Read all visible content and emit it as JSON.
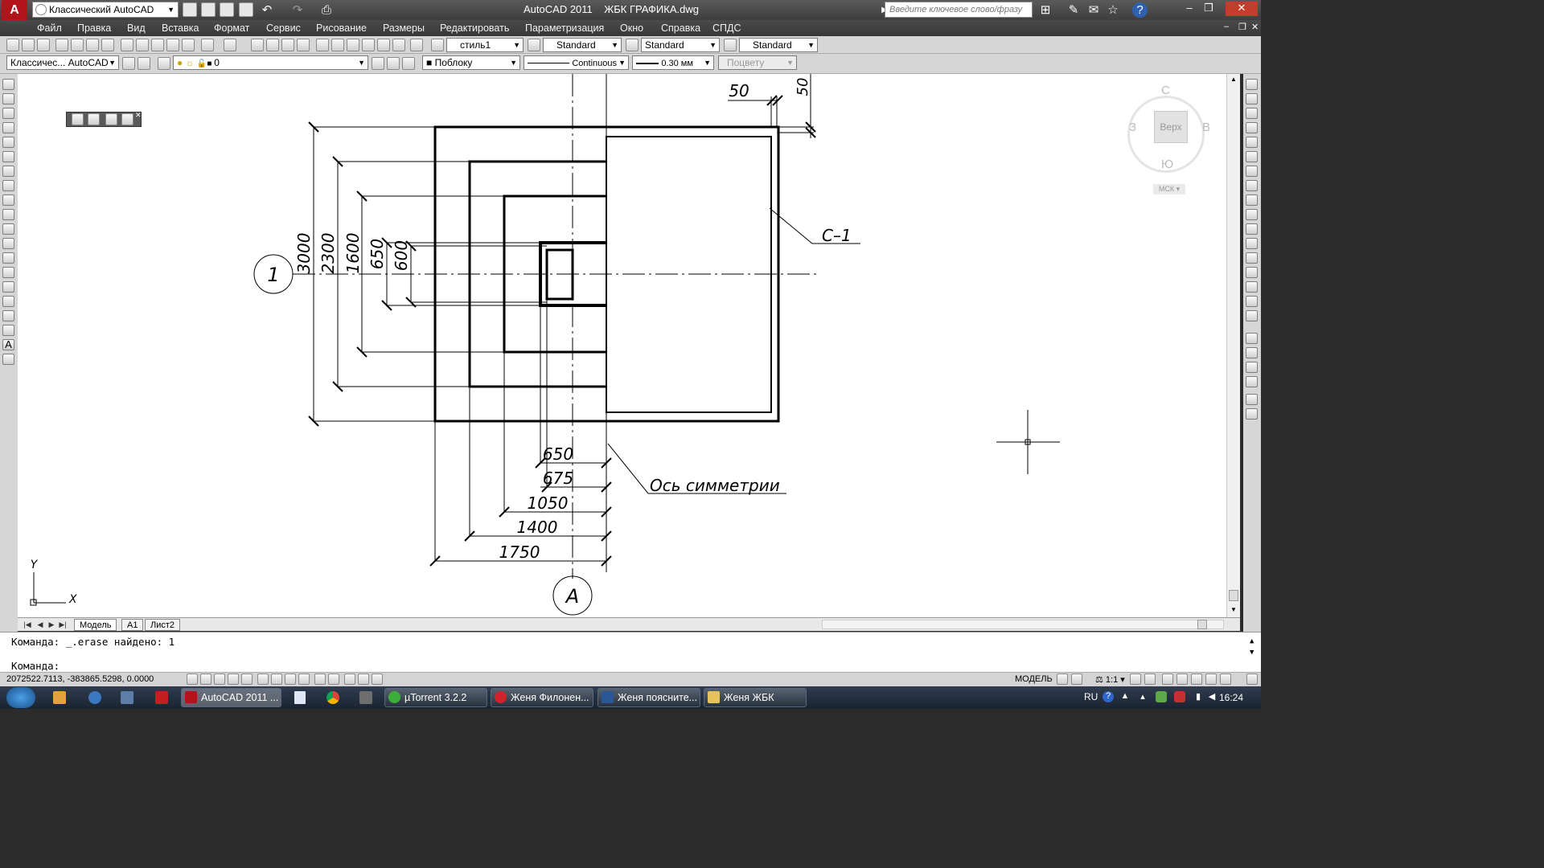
{
  "titlebar": {
    "workspace": "Классический AutoCAD",
    "app_title": "AutoCAD 2011",
    "document": "ЖБК ГРАФИКА.dwg",
    "search_placeholder": "Введите ключевое слово/фразу"
  },
  "menu": [
    "Файл",
    "Правка",
    "Вид",
    "Вставка",
    "Формат",
    "Сервис",
    "Рисование",
    "Размеры",
    "Редактировать",
    "Параметризация",
    "Окно",
    "Справка",
    "СПДС"
  ],
  "styles_toolbar": {
    "text_style": "стиль1",
    "dim_style": "Standard",
    "table_style": "Standard",
    "multileader_style": "Standard"
  },
  "layers_toolbar": {
    "workspace": "Классичес... AutoCAD",
    "layer": "0",
    "color": "Поблоку",
    "linetype": "Continuous",
    "lineweight": "0.30 мм",
    "plot_style": "Поцвету"
  },
  "viewcube": {
    "north": "С",
    "south": "Ю",
    "west": "З",
    "east": "В",
    "face": "Верх",
    "ucs": "МСК"
  },
  "drawing": {
    "row_axis": "1",
    "column_axis": "A",
    "vertical_dims": [
      "3000",
      "2300",
      "1600",
      "650",
      "600"
    ],
    "horizontal_dims": [
      "650",
      "675",
      "1050",
      "1400",
      "1750"
    ],
    "top_dims": [
      "50",
      "50"
    ],
    "section_label": "С–1",
    "symmetry_label": "Ось симметрии",
    "ucs_x": "X",
    "ucs_y": "Y"
  },
  "tabs": [
    "Модель",
    "A1",
    "Лист2"
  ],
  "command": {
    "history": "Команда:  _.erase найдено: 1",
    "prompt": "Команда:"
  },
  "status": {
    "coords": "2072522.7113, -383865.5298, 0.0000",
    "space": "МОДЕЛЬ",
    "scale": "1:1"
  },
  "taskbar": {
    "tasks": [
      "AutoCAD 2011 ...",
      "µTorrent 3.2.2",
      "Женя Филонен...",
      "Женя поясните...",
      "Женя ЖБК"
    ],
    "lang": "RU",
    "time": "16:24"
  },
  "colors": {
    "title_bg": "#3d3d3d",
    "logo_red": "#b1141b",
    "canvas_bg": "#ffffff",
    "taskbar_bg": "#1a2330"
  }
}
